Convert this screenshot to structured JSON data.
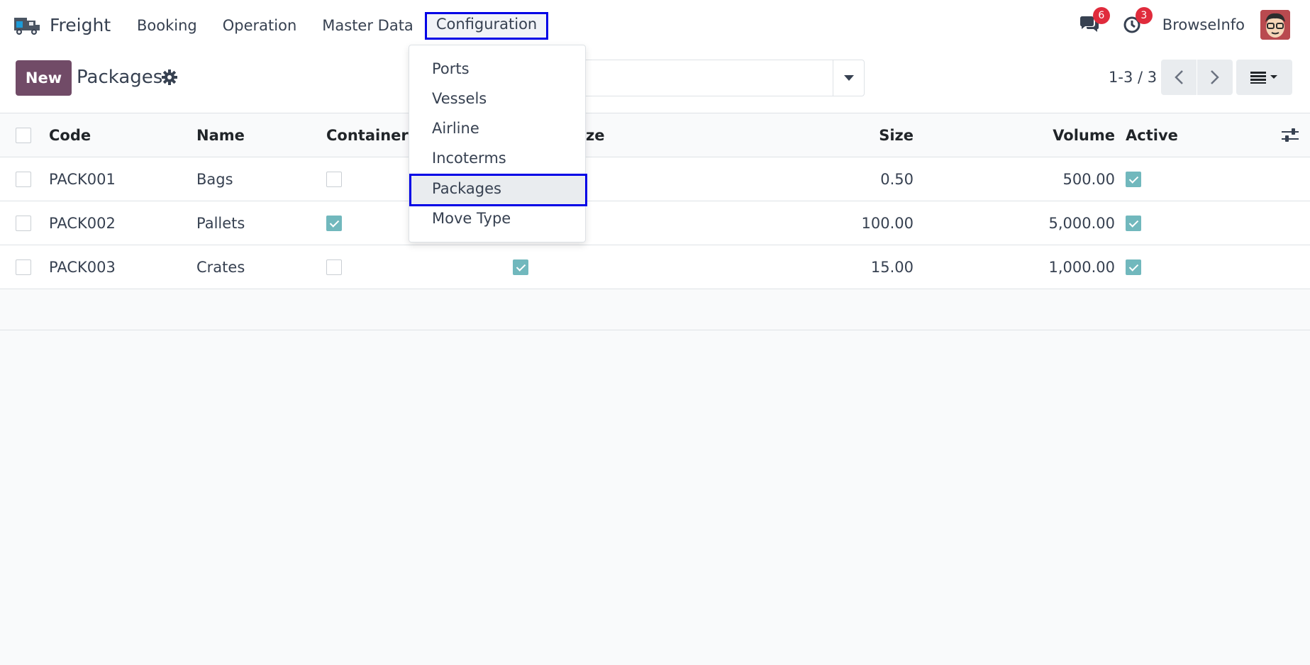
{
  "navbar": {
    "app_name": "Freight",
    "menu": [
      "Booking",
      "Operation",
      "Master Data",
      "Configuration"
    ],
    "messages_count": "6",
    "activities_count": "3",
    "company": "BrowseInfo"
  },
  "control": {
    "new_label": "New",
    "title": "Packages",
    "pager": "1-3 / 3"
  },
  "table": {
    "columns": [
      "Code",
      "Name",
      "Container",
      "ze",
      "Size",
      "Volume",
      "Active"
    ],
    "rows": [
      {
        "code": "PACK001",
        "name": "Bags",
        "container": false,
        "col4": false,
        "size": "0.50",
        "volume": "500.00",
        "active": true
      },
      {
        "code": "PACK002",
        "name": "Pallets",
        "container": true,
        "col4": false,
        "size": "100.00",
        "volume": "5,000.00",
        "active": true
      },
      {
        "code": "PACK003",
        "name": "Crates",
        "container": false,
        "col4": true,
        "size": "15.00",
        "volume": "1,000.00",
        "active": true
      }
    ]
  },
  "dropdown": {
    "items": [
      "Ports",
      "Vessels",
      "Airline",
      "Incoterms",
      "Packages",
      "Move Type"
    ],
    "active_index": 4
  },
  "colors": {
    "primary": "#714b67",
    "highlight": "#0000e6",
    "check": "#71b8bd",
    "badge": "#e02b3c"
  }
}
